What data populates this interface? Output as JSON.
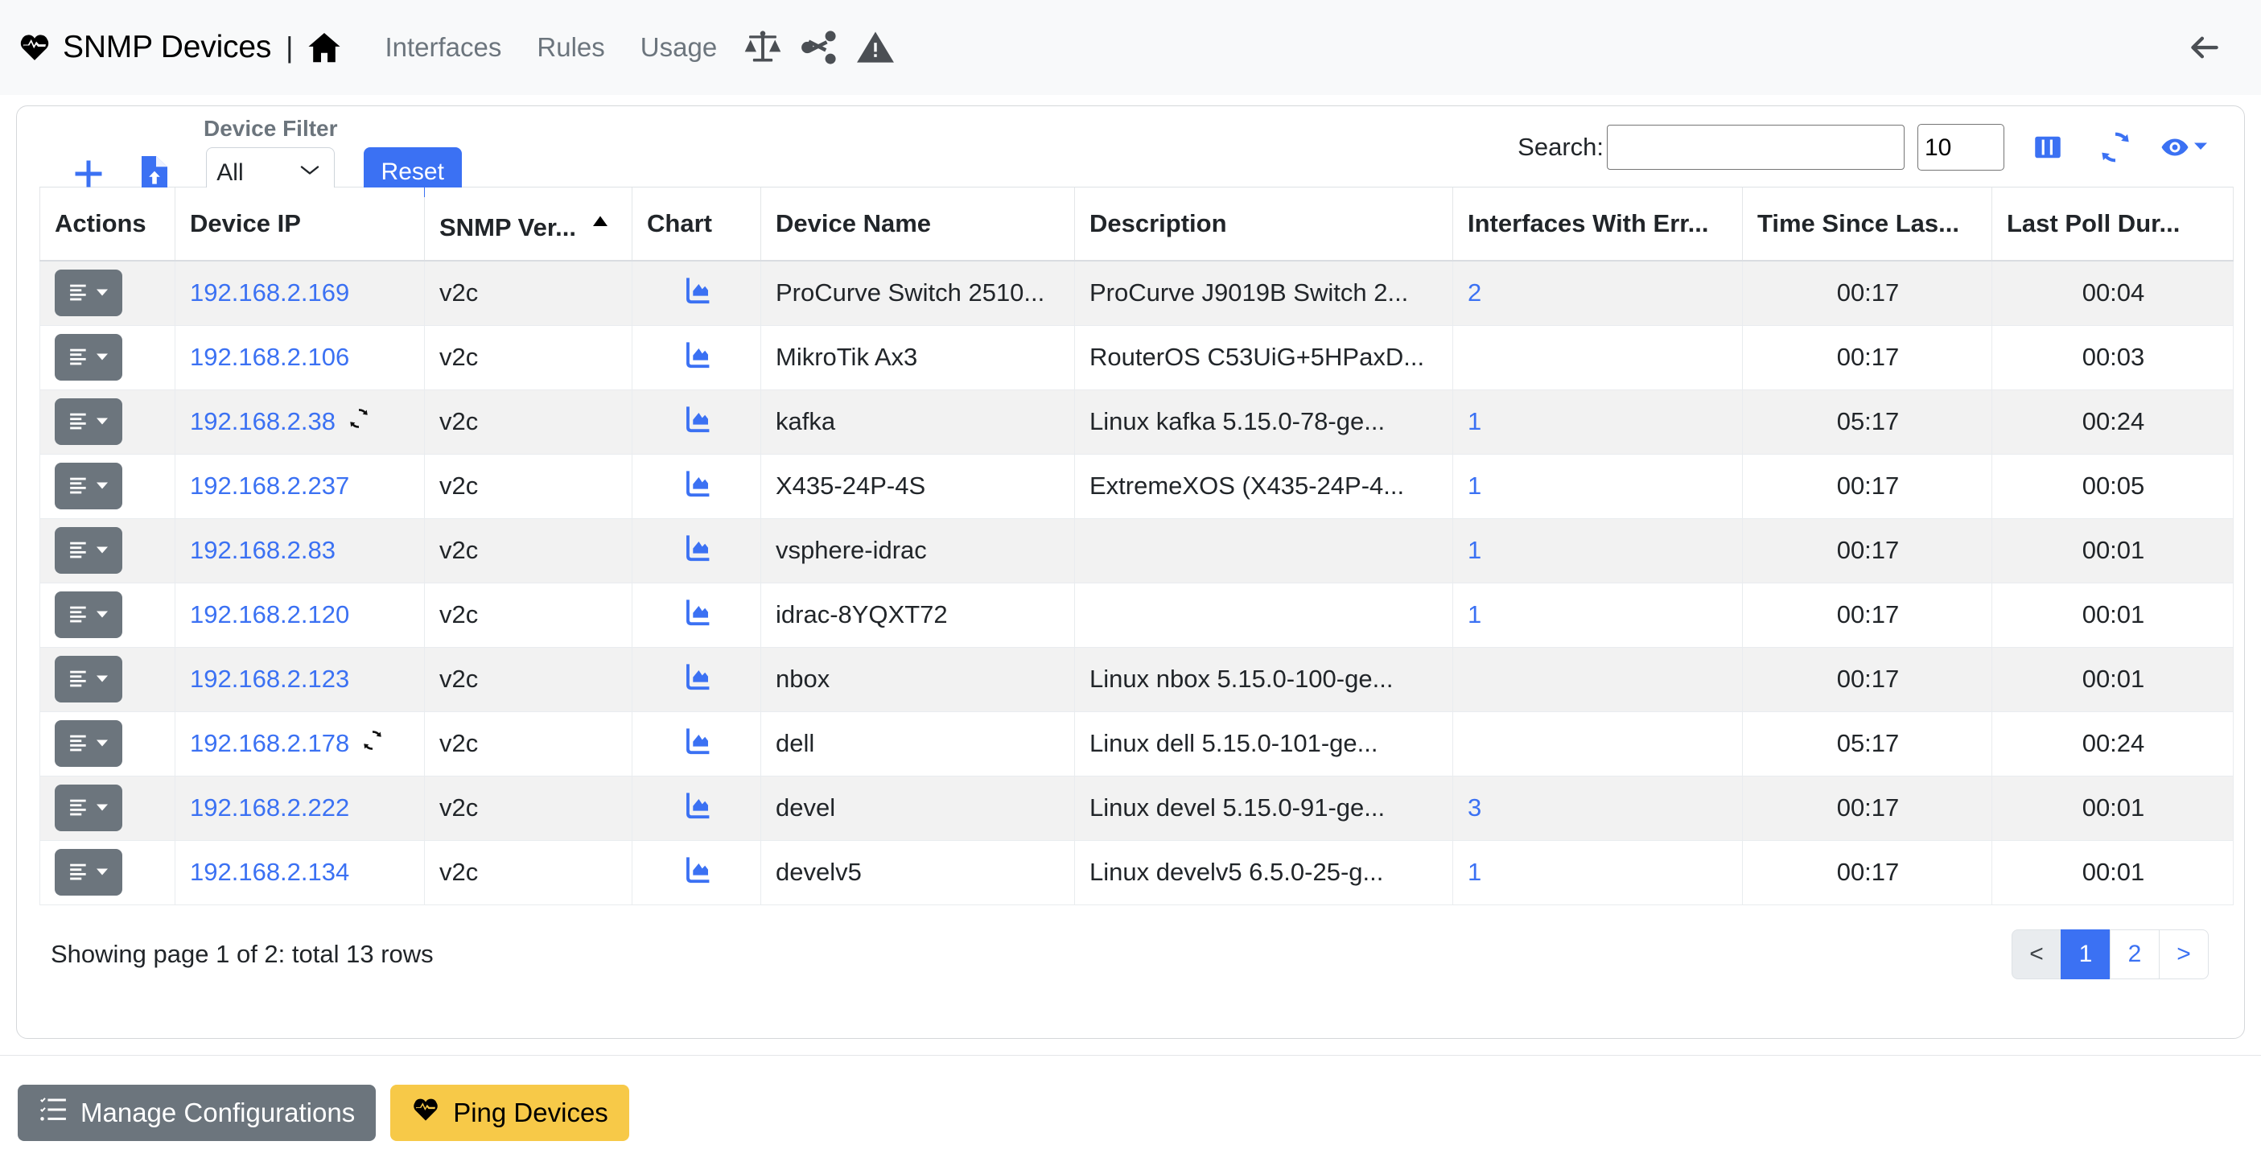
{
  "navbar": {
    "brand": "SNMP Devices",
    "separator": "|",
    "home_icon": "home-icon",
    "links": [
      {
        "label": "Interfaces"
      },
      {
        "label": "Rules"
      },
      {
        "label": "Usage"
      }
    ],
    "icons": [
      {
        "name": "balance-scale-icon"
      },
      {
        "name": "share-nodes-icon"
      },
      {
        "name": "warning-triangle-icon"
      }
    ],
    "back_icon": "arrow-left-icon"
  },
  "toolbar": {
    "add_icon": "plus-icon",
    "import_icon": "file-upload-icon",
    "filter_label": "Device Filter",
    "filter_value": "All",
    "filter_options": [
      "All"
    ],
    "reset_label": "Reset",
    "search_label": "Search:",
    "search_value": "",
    "search_placeholder": "",
    "page_length_value": "10",
    "page_length_options": [
      "10"
    ],
    "columns_icon": "columns-icon",
    "refresh_icon": "refresh-icon",
    "visibility_icon": "eye-icon"
  },
  "table": {
    "columns": [
      {
        "label": "Actions",
        "sort": "none"
      },
      {
        "label": "Device IP",
        "sort": "none"
      },
      {
        "label": "SNMP Ver...",
        "sort": "asc"
      },
      {
        "label": "Chart",
        "sort": "none"
      },
      {
        "label": "Device Name",
        "sort": "none"
      },
      {
        "label": "Description",
        "sort": "none"
      },
      {
        "label": "Interfaces With Err...",
        "sort": "none"
      },
      {
        "label": "Time Since Las...",
        "sort": "none"
      },
      {
        "label": "Last Poll Dur...",
        "sort": "none"
      }
    ],
    "rows": [
      {
        "ip": "192.168.2.169",
        "syncing": false,
        "version": "v2c",
        "device_name": "ProCurve Switch 2510...",
        "description": "ProCurve J9019B Switch 2...",
        "errors": "2",
        "time_since_last": "00:17",
        "last_poll_duration": "00:04"
      },
      {
        "ip": "192.168.2.106",
        "syncing": false,
        "version": "v2c",
        "device_name": "MikroTik Ax3",
        "description": "RouterOS C53UiG+5HPaxD...",
        "errors": "",
        "time_since_last": "00:17",
        "last_poll_duration": "00:03"
      },
      {
        "ip": "192.168.2.38",
        "syncing": true,
        "version": "v2c",
        "device_name": "kafka",
        "description": "Linux kafka 5.15.0-78-ge...",
        "errors": "1",
        "time_since_last": "05:17",
        "last_poll_duration": "00:24"
      },
      {
        "ip": "192.168.2.237",
        "syncing": false,
        "version": "v2c",
        "device_name": "X435-24P-4S",
        "description": "ExtremeXOS (X435-24P-4...",
        "errors": "1",
        "time_since_last": "00:17",
        "last_poll_duration": "00:05"
      },
      {
        "ip": "192.168.2.83",
        "syncing": false,
        "version": "v2c",
        "device_name": "vsphere-idrac",
        "description": "",
        "errors": "1",
        "time_since_last": "00:17",
        "last_poll_duration": "00:01"
      },
      {
        "ip": "192.168.2.120",
        "syncing": false,
        "version": "v2c",
        "device_name": "idrac-8YQXT72",
        "description": "",
        "errors": "1",
        "time_since_last": "00:17",
        "last_poll_duration": "00:01"
      },
      {
        "ip": "192.168.2.123",
        "syncing": false,
        "version": "v2c",
        "device_name": "nbox",
        "description": "Linux nbox 5.15.0-100-ge...",
        "errors": "",
        "time_since_last": "00:17",
        "last_poll_duration": "00:01"
      },
      {
        "ip": "192.168.2.178",
        "syncing": true,
        "version": "v2c",
        "device_name": "dell",
        "description": "Linux dell 5.15.0-101-ge...",
        "errors": "",
        "time_since_last": "05:17",
        "last_poll_duration": "00:24"
      },
      {
        "ip": "192.168.2.222",
        "syncing": false,
        "version": "v2c",
        "device_name": "devel",
        "description": "Linux devel 5.15.0-91-ge...",
        "errors": "3",
        "time_since_last": "00:17",
        "last_poll_duration": "00:01"
      },
      {
        "ip": "192.168.2.134",
        "syncing": false,
        "version": "v2c",
        "device_name": "develv5",
        "description": "Linux develv5 6.5.0-25-g...",
        "errors": "1",
        "time_since_last": "00:17",
        "last_poll_duration": "00:01"
      }
    ]
  },
  "footer": {
    "showing_text": "Showing page 1 of 2: total 13 rows",
    "pagination": [
      {
        "label": "<",
        "state": "disabled"
      },
      {
        "label": "1",
        "state": "active"
      },
      {
        "label": "2",
        "state": "normal"
      },
      {
        "label": ">",
        "state": "normal"
      }
    ]
  },
  "bottom_bar": {
    "manage_label": "Manage Configurations",
    "manage_icon": "tasks-list-icon",
    "ping_label": "Ping Devices",
    "ping_icon": "heart-pulse-icon"
  },
  "colors": {
    "accent_blue": "#3b71f3",
    "link_blue": "#3b71f3",
    "secondary_gray": "#6c757d",
    "warning_yellow": "#f7c948",
    "navbar_bg": "#f8f9fa",
    "row_odd_bg": "#f2f2f2"
  }
}
